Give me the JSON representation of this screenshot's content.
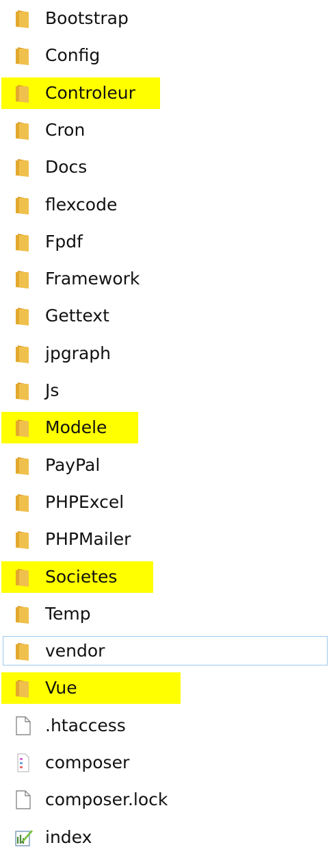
{
  "explorer": {
    "items": [
      {
        "name": "Bootstrap",
        "type": "folder",
        "icon": "folder-icon",
        "highlighted": false,
        "selected": false
      },
      {
        "name": "Config",
        "type": "folder",
        "icon": "folder-icon",
        "highlighted": false,
        "selected": false
      },
      {
        "name": "Controleur",
        "type": "folder",
        "icon": "folder-icon",
        "highlighted": true,
        "selected": false
      },
      {
        "name": "Cron",
        "type": "folder",
        "icon": "folder-icon",
        "highlighted": false,
        "selected": false
      },
      {
        "name": "Docs",
        "type": "folder",
        "icon": "folder-icon",
        "highlighted": false,
        "selected": false
      },
      {
        "name": "flexcode",
        "type": "folder",
        "icon": "folder-icon",
        "highlighted": false,
        "selected": false
      },
      {
        "name": "Fpdf",
        "type": "folder",
        "icon": "folder-icon",
        "highlighted": false,
        "selected": false
      },
      {
        "name": "Framework",
        "type": "folder",
        "icon": "folder-icon",
        "highlighted": false,
        "selected": false
      },
      {
        "name": "Gettext",
        "type": "folder",
        "icon": "folder-icon",
        "highlighted": false,
        "selected": false
      },
      {
        "name": "jpgraph",
        "type": "folder",
        "icon": "folder-icon",
        "highlighted": false,
        "selected": false
      },
      {
        "name": "Js",
        "type": "folder",
        "icon": "folder-icon",
        "highlighted": false,
        "selected": false
      },
      {
        "name": "Modele",
        "type": "folder",
        "icon": "folder-icon",
        "highlighted": true,
        "selected": false
      },
      {
        "name": "PayPal",
        "type": "folder",
        "icon": "folder-icon",
        "highlighted": false,
        "selected": false
      },
      {
        "name": "PHPExcel",
        "type": "folder",
        "icon": "folder-icon",
        "highlighted": false,
        "selected": false
      },
      {
        "name": "PHPMailer",
        "type": "folder",
        "icon": "folder-icon",
        "highlighted": false,
        "selected": false
      },
      {
        "name": "Societes",
        "type": "folder",
        "icon": "folder-icon",
        "highlighted": true,
        "selected": false
      },
      {
        "name": "Temp",
        "type": "folder",
        "icon": "folder-icon",
        "highlighted": false,
        "selected": false
      },
      {
        "name": "vendor",
        "type": "folder",
        "icon": "folder-icon",
        "highlighted": false,
        "selected": true
      },
      {
        "name": "Vue",
        "type": "folder",
        "icon": "folder-icon",
        "highlighted": true,
        "selected": false
      },
      {
        "name": ".htaccess",
        "type": "file",
        "icon": "blank-file-icon",
        "highlighted": false,
        "selected": false
      },
      {
        "name": "composer",
        "type": "file",
        "icon": "json-file-icon",
        "highlighted": false,
        "selected": false
      },
      {
        "name": "composer.lock",
        "type": "file",
        "icon": "blank-file-icon",
        "highlighted": false,
        "selected": false
      },
      {
        "name": "index",
        "type": "file",
        "icon": "php-file-icon",
        "highlighted": false,
        "selected": false
      }
    ]
  },
  "colors": {
    "highlight": "#ffff00",
    "folder": "#e8b13c",
    "selection_border": "#99c9ef",
    "text": "#111111"
  }
}
